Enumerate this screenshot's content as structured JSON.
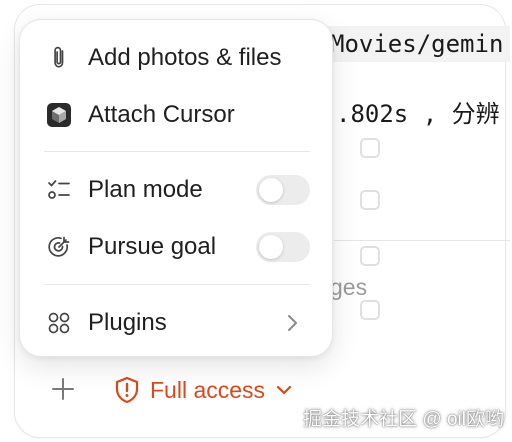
{
  "background": {
    "code_line_1": "Movies/gemin",
    "code_line_2": ".802s , 分辨",
    "partial_text": "ges"
  },
  "menu": {
    "items": [
      {
        "label": "Add photos & files",
        "icon": "paperclip-icon"
      },
      {
        "label": "Attach Cursor",
        "icon": "cursor-app-icon"
      },
      {
        "label": "Plan mode",
        "icon": "checklist-icon",
        "toggle": false
      },
      {
        "label": "Pursue goal",
        "icon": "goal-target-icon",
        "toggle": false
      },
      {
        "label": "Plugins",
        "icon": "plugins-grid-icon",
        "submenu": true
      }
    ]
  },
  "toolbar": {
    "plus_icon": "plus-icon",
    "access_label": "Full access",
    "access_icon": "shield-alert-icon",
    "access_color": "#d84a1b"
  },
  "watermark": "掘金技术社区 @ oil欧哟"
}
